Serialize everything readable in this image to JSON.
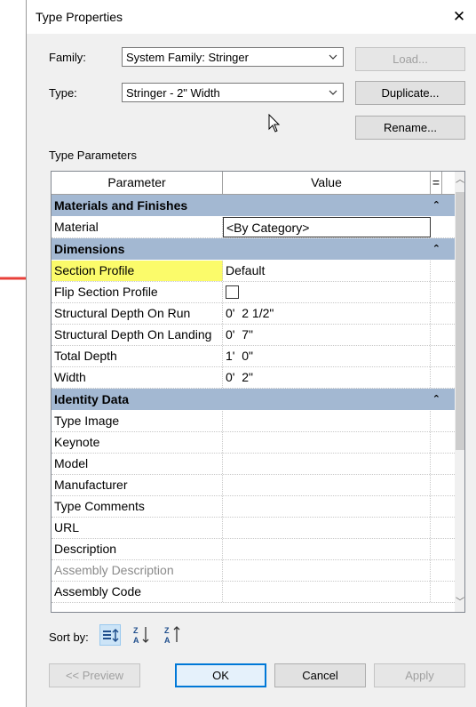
{
  "window": {
    "title": "Type Properties"
  },
  "family": {
    "label": "Family:",
    "value": "System Family: Stringer"
  },
  "type": {
    "label": "Type:",
    "value": "Stringer - 2\" Width"
  },
  "buttons": {
    "load": "Load...",
    "duplicate": "Duplicate...",
    "rename": "Rename...",
    "preview": "<< Preview",
    "ok": "OK",
    "cancel": "Cancel",
    "apply": "Apply"
  },
  "type_parameters_label": "Type Parameters",
  "grid": {
    "col_parameter": "Parameter",
    "col_value": "Value",
    "col_eq": "=",
    "groups": [
      {
        "name": "Materials and Finishes",
        "rows": [
          {
            "param": "Material",
            "value": "<By Category>"
          }
        ]
      },
      {
        "name": "Dimensions",
        "rows": [
          {
            "param": "Section Profile",
            "value": "Default"
          },
          {
            "param": "Flip Section Profile",
            "value": ""
          },
          {
            "param": "Structural Depth On Run",
            "value": "0'  2 1/2\""
          },
          {
            "param": "Structural Depth On Landing",
            "value": "0'  7\""
          },
          {
            "param": "Total Depth",
            "value": "1'  0\""
          },
          {
            "param": "Width",
            "value": "0'  2\""
          }
        ]
      },
      {
        "name": "Identity Data",
        "rows": [
          {
            "param": "Type Image",
            "value": ""
          },
          {
            "param": "Keynote",
            "value": ""
          },
          {
            "param": "Model",
            "value": ""
          },
          {
            "param": "Manufacturer",
            "value": ""
          },
          {
            "param": "Type Comments",
            "value": ""
          },
          {
            "param": "URL",
            "value": ""
          },
          {
            "param": "Description",
            "value": ""
          },
          {
            "param": "Assembly Description",
            "value": ""
          },
          {
            "param": "Assembly Code",
            "value": ""
          }
        ]
      }
    ]
  },
  "sort": {
    "label": "Sort by:"
  },
  "colors": {
    "group_header": "#a3b8d2",
    "highlight": "#fbfb6a",
    "annotation_arrow": "#e8403a",
    "accent": "#0078d7"
  }
}
